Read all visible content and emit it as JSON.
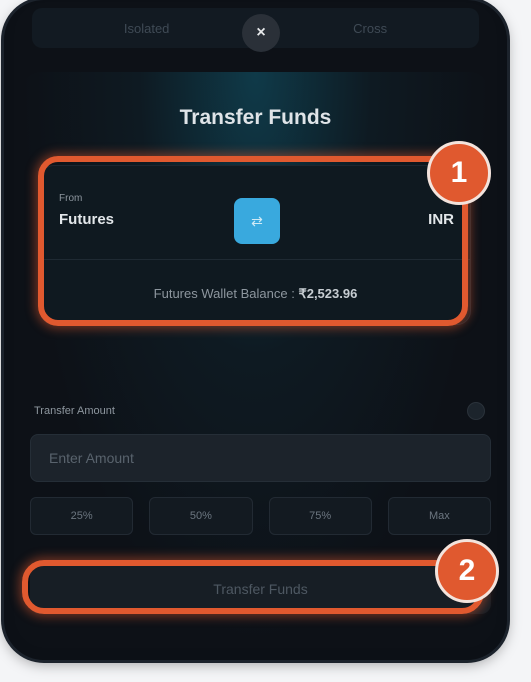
{
  "tabs": [
    "Isolated",
    "Cross"
  ],
  "close_icon": "×",
  "title": "Transfer Funds",
  "card": {
    "from_label": "From",
    "from_value": "Futures",
    "swap_icon": "⇄",
    "currency": "INR",
    "balance_label": "Futures Wallet Balance :",
    "balance_value": "₹2,523.96"
  },
  "amount": {
    "label": "Transfer Amount",
    "placeholder": "Enter Amount"
  },
  "percentages": [
    "25%",
    "50%",
    "75%",
    "Max"
  ],
  "transfer_button": "Transfer Funds",
  "annotations": [
    "1",
    "2"
  ],
  "colors": {
    "accent": "#39a9de",
    "highlight": "#e0592f",
    "background": "#0d1117"
  }
}
